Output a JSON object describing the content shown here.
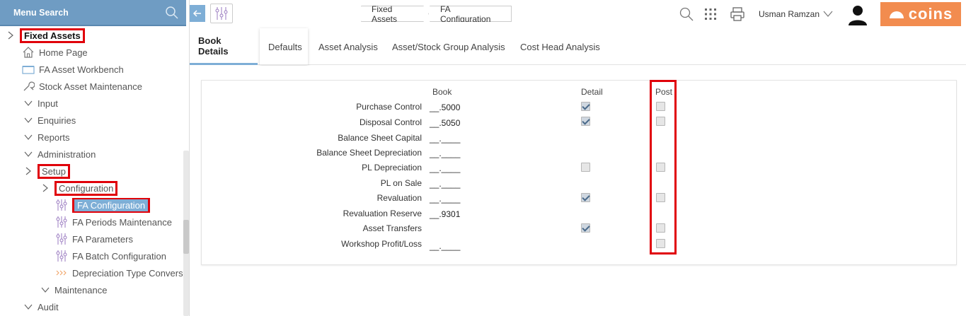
{
  "sidebar": {
    "menu_search_label": "Menu Search",
    "items": [
      {
        "label": "Fixed Assets"
      },
      {
        "label": "Home Page"
      },
      {
        "label": "FA Asset Workbench"
      },
      {
        "label": "Stock Asset Maintenance"
      },
      {
        "label": "Input"
      },
      {
        "label": "Enquiries"
      },
      {
        "label": "Reports"
      },
      {
        "label": "Administration"
      },
      {
        "label": "Setup"
      },
      {
        "label": "Configuration"
      },
      {
        "label": "FA Configuration"
      },
      {
        "label": "FA Periods Maintenance"
      },
      {
        "label": "FA Parameters"
      },
      {
        "label": "FA Batch Configuration"
      },
      {
        "label": "Depreciation Type Convers"
      },
      {
        "label": "Maintenance"
      },
      {
        "label": "Audit"
      }
    ]
  },
  "breadcrumb": [
    "Fixed Assets",
    "FA Configuration"
  ],
  "user": {
    "name": "Usman Ramzan"
  },
  "logo_text": "coins",
  "colors": {
    "accent": "#7eaed6",
    "logo": "#f28c4f",
    "highlight": "#e0000a"
  },
  "tabs": [
    {
      "label": "Book Details"
    },
    {
      "label": "Defaults"
    },
    {
      "label": "Asset Analysis"
    },
    {
      "label": "Asset/Stock Group Analysis"
    },
    {
      "label": "Cost Head Analysis"
    }
  ],
  "table": {
    "headers": {
      "book": "Book",
      "detail": "Detail",
      "post": "Post"
    },
    "rows": [
      {
        "label": "Purchase Control",
        "book": "__.5000",
        "detail": true,
        "post": false
      },
      {
        "label": "Disposal Control",
        "book": "__.5050",
        "detail": true,
        "post": false
      },
      {
        "label": "Balance Sheet Capital",
        "book": "__.____"
      },
      {
        "label": "Balance Sheet Depreciation",
        "book": "__.____"
      },
      {
        "label": "PL Depreciation",
        "book": "__.____",
        "detail": false,
        "post": false
      },
      {
        "label": "PL on Sale",
        "book": "__.____"
      },
      {
        "label": "Revaluation",
        "book": "__.____",
        "detail": true,
        "post": false
      },
      {
        "label": "Revaluation Reserve",
        "book": "__.9301"
      },
      {
        "label": "Asset Transfers",
        "book": "",
        "detail": true,
        "post": false
      },
      {
        "label": "Workshop Profit/Loss",
        "book": "__.____",
        "post": false
      }
    ]
  }
}
